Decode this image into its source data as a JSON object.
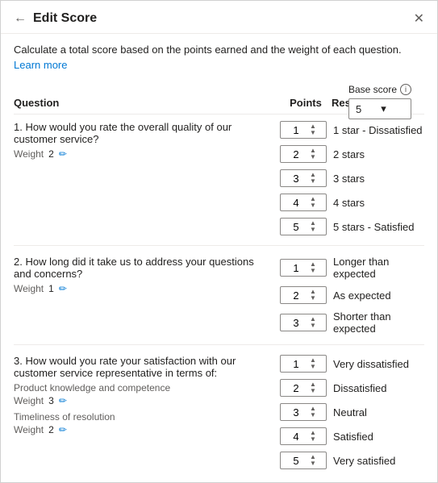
{
  "header": {
    "back_icon": "←",
    "title": "Edit Score",
    "close_icon": "✕"
  },
  "description": {
    "text": "Calculate a total score based on the points earned and the weight of each question.",
    "link_text": "Learn more"
  },
  "base_score": {
    "label": "Base score",
    "value": "5",
    "info_icon": "i"
  },
  "columns": {
    "question": "Question",
    "points": "Points",
    "response": "Response"
  },
  "questions": [
    {
      "id": 1,
      "text": "1. How would you rate the overall quality of our customer service?",
      "weight_label": "Weight",
      "weight_value": "2",
      "rows": [
        {
          "points": "1",
          "response": "1 star - Dissatisfied"
        },
        {
          "points": "2",
          "response": "2 stars"
        },
        {
          "points": "3",
          "response": "3 stars"
        },
        {
          "points": "4",
          "response": "4 stars"
        },
        {
          "points": "5",
          "response": "5 stars - Satisfied"
        }
      ]
    },
    {
      "id": 2,
      "text": "2. How long did it take us to address your questions and concerns?",
      "weight_label": "Weight",
      "weight_value": "1",
      "rows": [
        {
          "points": "1",
          "response": "Longer than expected"
        },
        {
          "points": "2",
          "response": "As expected"
        },
        {
          "points": "3",
          "response": "Shorter than expected"
        }
      ]
    },
    {
      "id": 3,
      "text": "3. How would you rate your satisfaction with our customer service representative in terms of:",
      "sub_items": [
        {
          "label": "Product knowledge and competence",
          "weight_label": "Weight",
          "weight_value": "3"
        },
        {
          "label": "Timeliness of resolution",
          "weight_label": "Weight",
          "weight_value": "2"
        }
      ],
      "rows": [
        {
          "points": "1",
          "response": "Very dissatisfied"
        },
        {
          "points": "2",
          "response": "Dissatisfied"
        },
        {
          "points": "3",
          "response": "Neutral"
        },
        {
          "points": "4",
          "response": "Satisfied"
        },
        {
          "points": "5",
          "response": "Very satisfied"
        }
      ]
    }
  ]
}
